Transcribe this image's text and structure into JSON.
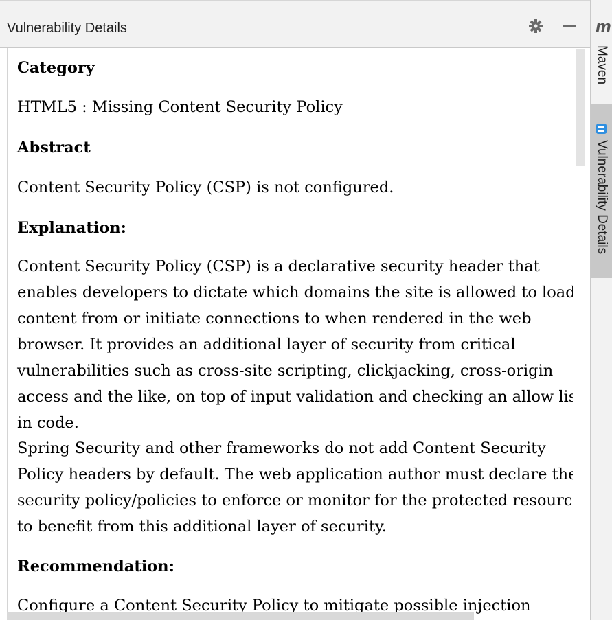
{
  "panel": {
    "title": "Vulnerability Details"
  },
  "icons": {
    "settings": "gear-icon",
    "minimize": "minimize-icon",
    "maven_logo": "maven-logo-icon",
    "vulnerability_tab": "vulnerability-details-icon"
  },
  "content": {
    "category_heading": "Category",
    "category_value": "HTML5 : Missing Content Security Policy",
    "abstract_heading": "Abstract",
    "abstract_text": "Content Security Policy (CSP) is not configured.",
    "explanation_heading": "Explanation:",
    "explanation_lines": [
      "Content Security Policy (CSP) is a declarative security header that",
      "enables developers to dictate which domains the site is allowed to load",
      "content from or initiate connections to when rendered in the web",
      "browser. It provides an additional layer of security from critical",
      "vulnerabilities such as cross-site scripting, clickjacking, cross-origin",
      "access and the like, on top of input validation and checking an allow list",
      "in code.",
      "Spring Security and other frameworks do not add Content Security",
      "Policy headers by default. The web application author must declare the",
      "security policy/policies to enforce or monitor for the protected resources",
      "to benefit from this additional layer of security."
    ],
    "recommendation_heading": "Recommendation:",
    "recommendation_lines": [
      "Configure a Content Security Policy to mitigate possible injection"
    ]
  },
  "side_strip": {
    "logo_text": "m",
    "tabs": [
      {
        "label": "Maven"
      },
      {
        "label": "Vulnerability Details"
      }
    ]
  },
  "colors": {
    "panel_header_bg": "#f2f2f2",
    "content_bg": "#ffffff",
    "active_tab_bg": "#c8c8c8",
    "tab_icon_blue": "#2f8fe0"
  }
}
